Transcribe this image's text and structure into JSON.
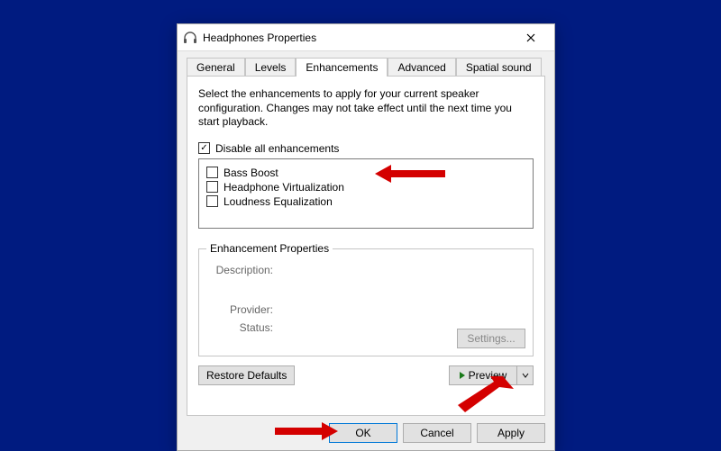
{
  "window": {
    "title": "Headphones Properties"
  },
  "tabs": {
    "general": "General",
    "levels": "Levels",
    "enhancements": "Enhancements",
    "advanced": "Advanced",
    "spatial": "Spatial sound"
  },
  "body": {
    "intro": "Select the enhancements to apply for your current speaker configuration. Changes may not take effect until the next time you start playback.",
    "disable_all": "Disable all enhancements",
    "items": {
      "bass": "Bass Boost",
      "virt": "Headphone Virtualization",
      "loud": "Loudness Equalization"
    },
    "group": {
      "legend": "Enhancement Properties",
      "description_k": "Description:",
      "provider_k": "Provider:",
      "status_k": "Status:",
      "settings": "Settings..."
    },
    "restore": "Restore Defaults",
    "preview": "Preview"
  },
  "footer": {
    "ok": "OK",
    "cancel": "Cancel",
    "apply": "Apply"
  }
}
